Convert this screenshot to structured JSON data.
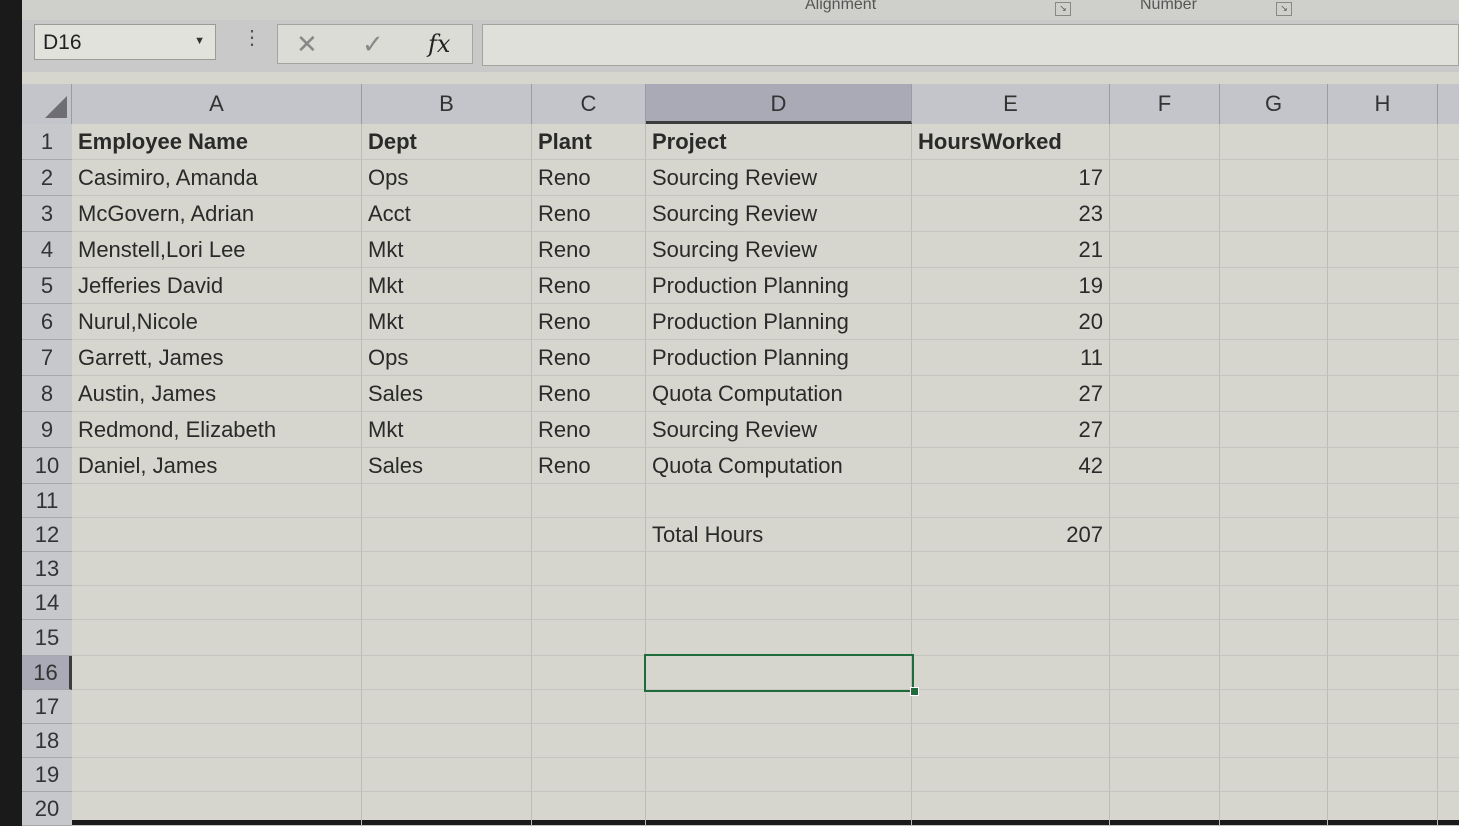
{
  "ribbon": {
    "groups": [
      {
        "label": "Alignment"
      },
      {
        "label": "Number"
      }
    ]
  },
  "formula_bar": {
    "name_box": "D16",
    "cancel_icon": "close-icon",
    "enter_icon": "check-icon",
    "function_label": "fx",
    "formula_value": ""
  },
  "columns": [
    "A",
    "B",
    "C",
    "D",
    "E",
    "F",
    "G",
    "H"
  ],
  "selected_column": "D",
  "selected_row": "16",
  "rows": [
    "1",
    "2",
    "3",
    "4",
    "5",
    "6",
    "7",
    "8",
    "9",
    "10",
    "11",
    "12",
    "13",
    "14",
    "15",
    "16",
    "17",
    "18",
    "19",
    "20"
  ],
  "table": {
    "headers": [
      "Employee Name",
      "Dept",
      "Plant",
      "Project",
      "HoursWorked"
    ],
    "records": [
      {
        "name": "Casimiro, Amanda",
        "dept": "Ops",
        "plant": "Reno",
        "project": "Sourcing Review",
        "hours": "17"
      },
      {
        "name": "McGovern, Adrian",
        "dept": "Acct",
        "plant": "Reno",
        "project": "Sourcing Review",
        "hours": "23"
      },
      {
        "name": "Menstell,Lori  Lee",
        "dept": "Mkt",
        "plant": "Reno",
        "project": "Sourcing Review",
        "hours": "21"
      },
      {
        "name": "Jefferies David",
        "dept": "Mkt",
        "plant": "Reno",
        "project": "Production Planning",
        "hours": "19"
      },
      {
        "name": "Nurul,Nicole",
        "dept": "Mkt",
        "plant": "Reno",
        "project": "Production Planning",
        "hours": "20"
      },
      {
        "name": "Garrett, James",
        "dept": "Ops",
        "plant": "Reno",
        "project": "Production Planning",
        "hours": "11"
      },
      {
        "name": "Austin, James",
        "dept": "Sales",
        "plant": "Reno",
        "project": "Quota Computation",
        "hours": "27"
      },
      {
        "name": "Redmond, Elizabeth",
        "dept": "Mkt",
        "plant": "Reno",
        "project": "Sourcing Review",
        "hours": "27"
      },
      {
        "name": "Daniel, James",
        "dept": "Sales",
        "plant": "Reno",
        "project": "Quota Computation",
        "hours": "42"
      }
    ],
    "total_label": "Total Hours",
    "total_value": "207"
  }
}
